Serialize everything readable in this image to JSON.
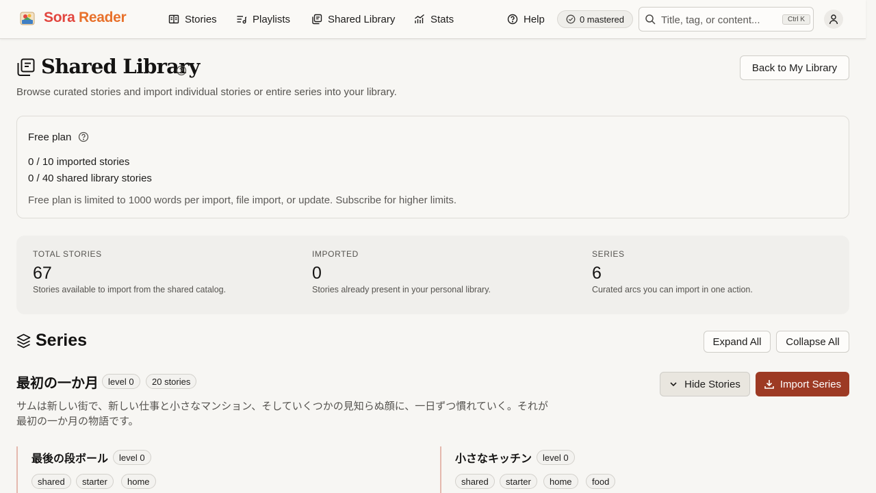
{
  "app": {
    "brand_part1": "Sora ",
    "brand_part2": "Reader"
  },
  "nav": [
    {
      "label": "Stories",
      "icon": "book-open-icon"
    },
    {
      "label": "Playlists",
      "icon": "playlist-icon"
    },
    {
      "label": "Shared Library",
      "icon": "library-icon"
    },
    {
      "label": "Stats",
      "icon": "chart-icon"
    }
  ],
  "header": {
    "help_label": "Help",
    "mastered_label": "0 mastered",
    "search_placeholder": "Title, tag, or content...",
    "search_shortcut": "Ctrl K"
  },
  "page": {
    "title": "Shared Library",
    "subtitle": "Browse curated stories and import individual stories or entire series into your library.",
    "back_button": "Back to My Library"
  },
  "plan": {
    "title": "Free plan",
    "imported": "0 / 10 imported stories",
    "shared": "0 / 40 shared library stories",
    "note": "Free plan is limited to 1000 words per import, file import, or update. Subscribe for higher limits."
  },
  "stats": [
    {
      "label": "TOTAL STORIES",
      "value": "67",
      "desc": "Stories available to import from the shared catalog."
    },
    {
      "label": "IMPORTED",
      "value": "0",
      "desc": "Stories already present in your personal library."
    },
    {
      "label": "SERIES",
      "value": "6",
      "desc": "Curated arcs you can import in one action."
    }
  ],
  "series": {
    "title": "Series",
    "expand_all": "Expand All",
    "collapse_all": "Collapse All",
    "items": [
      {
        "title": "最初の一か月",
        "level": "level 0",
        "count": "20 stories",
        "description": "サムは新しい街で、新しい仕事と小さなマンション、そしていくつかの見知らぬ顔に、一日ずつ慣れていく。それが最初の一か月の物語です。",
        "hide_button": "Hide Stories",
        "import_button": "Import Series",
        "stories": [
          {
            "title": "最後の段ボール",
            "level": "level 0",
            "tags": [
              "shared",
              "starter",
              "home"
            ]
          },
          {
            "title": "小さなキッチン",
            "level": "level 0",
            "tags": [
              "shared",
              "starter",
              "home",
              "food"
            ]
          }
        ]
      }
    ]
  },
  "colors": {
    "brand_red": "#e2463f",
    "brand_orange": "#e8712b",
    "import_button": "#9d3a24"
  }
}
